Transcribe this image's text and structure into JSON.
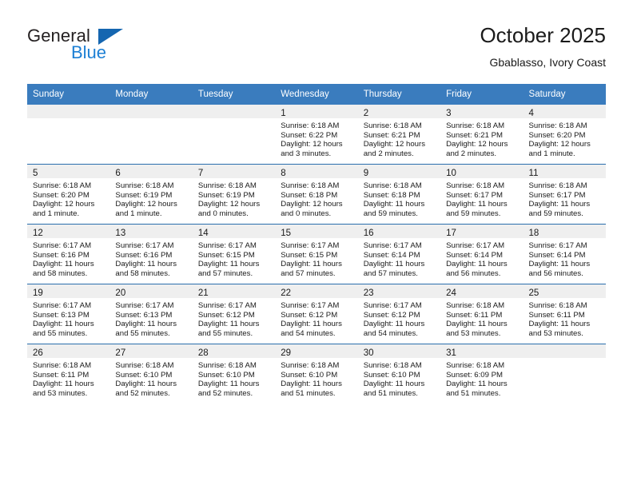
{
  "brand": {
    "name_part1": "General",
    "name_part2": "Blue",
    "logo_icon": "triangle-logo-icon",
    "accent_color": "#1566b0",
    "blue_text_color": "#1c7fd4"
  },
  "header": {
    "title": "October 2025",
    "subtitle": "Gbablasso, Ivory Coast"
  },
  "calendar": {
    "header_bg": "#3a7cbe",
    "daynum_bg": "#efefef",
    "row_border_color": "#2a6ead",
    "weekdays": [
      "Sunday",
      "Monday",
      "Tuesday",
      "Wednesday",
      "Thursday",
      "Friday",
      "Saturday"
    ],
    "weeks": [
      [
        {
          "day": "",
          "empty": true,
          "sunrise": "",
          "sunset": "",
          "daylight_line1": "",
          "daylight_line2": ""
        },
        {
          "day": "",
          "empty": true,
          "sunrise": "",
          "sunset": "",
          "daylight_line1": "",
          "daylight_line2": ""
        },
        {
          "day": "",
          "empty": true,
          "sunrise": "",
          "sunset": "",
          "daylight_line1": "",
          "daylight_line2": ""
        },
        {
          "day": "1",
          "empty": false,
          "sunrise": "Sunrise: 6:18 AM",
          "sunset": "Sunset: 6:22 PM",
          "daylight_line1": "Daylight: 12 hours",
          "daylight_line2": "and 3 minutes."
        },
        {
          "day": "2",
          "empty": false,
          "sunrise": "Sunrise: 6:18 AM",
          "sunset": "Sunset: 6:21 PM",
          "daylight_line1": "Daylight: 12 hours",
          "daylight_line2": "and 2 minutes."
        },
        {
          "day": "3",
          "empty": false,
          "sunrise": "Sunrise: 6:18 AM",
          "sunset": "Sunset: 6:21 PM",
          "daylight_line1": "Daylight: 12 hours",
          "daylight_line2": "and 2 minutes."
        },
        {
          "day": "4",
          "empty": false,
          "sunrise": "Sunrise: 6:18 AM",
          "sunset": "Sunset: 6:20 PM",
          "daylight_line1": "Daylight: 12 hours",
          "daylight_line2": "and 1 minute."
        }
      ],
      [
        {
          "day": "5",
          "empty": false,
          "sunrise": "Sunrise: 6:18 AM",
          "sunset": "Sunset: 6:20 PM",
          "daylight_line1": "Daylight: 12 hours",
          "daylight_line2": "and 1 minute."
        },
        {
          "day": "6",
          "empty": false,
          "sunrise": "Sunrise: 6:18 AM",
          "sunset": "Sunset: 6:19 PM",
          "daylight_line1": "Daylight: 12 hours",
          "daylight_line2": "and 1 minute."
        },
        {
          "day": "7",
          "empty": false,
          "sunrise": "Sunrise: 6:18 AM",
          "sunset": "Sunset: 6:19 PM",
          "daylight_line1": "Daylight: 12 hours",
          "daylight_line2": "and 0 minutes."
        },
        {
          "day": "8",
          "empty": false,
          "sunrise": "Sunrise: 6:18 AM",
          "sunset": "Sunset: 6:18 PM",
          "daylight_line1": "Daylight: 12 hours",
          "daylight_line2": "and 0 minutes."
        },
        {
          "day": "9",
          "empty": false,
          "sunrise": "Sunrise: 6:18 AM",
          "sunset": "Sunset: 6:18 PM",
          "daylight_line1": "Daylight: 11 hours",
          "daylight_line2": "and 59 minutes."
        },
        {
          "day": "10",
          "empty": false,
          "sunrise": "Sunrise: 6:18 AM",
          "sunset": "Sunset: 6:17 PM",
          "daylight_line1": "Daylight: 11 hours",
          "daylight_line2": "and 59 minutes."
        },
        {
          "day": "11",
          "empty": false,
          "sunrise": "Sunrise: 6:18 AM",
          "sunset": "Sunset: 6:17 PM",
          "daylight_line1": "Daylight: 11 hours",
          "daylight_line2": "and 59 minutes."
        }
      ],
      [
        {
          "day": "12",
          "empty": false,
          "sunrise": "Sunrise: 6:17 AM",
          "sunset": "Sunset: 6:16 PM",
          "daylight_line1": "Daylight: 11 hours",
          "daylight_line2": "and 58 minutes."
        },
        {
          "day": "13",
          "empty": false,
          "sunrise": "Sunrise: 6:17 AM",
          "sunset": "Sunset: 6:16 PM",
          "daylight_line1": "Daylight: 11 hours",
          "daylight_line2": "and 58 minutes."
        },
        {
          "day": "14",
          "empty": false,
          "sunrise": "Sunrise: 6:17 AM",
          "sunset": "Sunset: 6:15 PM",
          "daylight_line1": "Daylight: 11 hours",
          "daylight_line2": "and 57 minutes."
        },
        {
          "day": "15",
          "empty": false,
          "sunrise": "Sunrise: 6:17 AM",
          "sunset": "Sunset: 6:15 PM",
          "daylight_line1": "Daylight: 11 hours",
          "daylight_line2": "and 57 minutes."
        },
        {
          "day": "16",
          "empty": false,
          "sunrise": "Sunrise: 6:17 AM",
          "sunset": "Sunset: 6:14 PM",
          "daylight_line1": "Daylight: 11 hours",
          "daylight_line2": "and 57 minutes."
        },
        {
          "day": "17",
          "empty": false,
          "sunrise": "Sunrise: 6:17 AM",
          "sunset": "Sunset: 6:14 PM",
          "daylight_line1": "Daylight: 11 hours",
          "daylight_line2": "and 56 minutes."
        },
        {
          "day": "18",
          "empty": false,
          "sunrise": "Sunrise: 6:17 AM",
          "sunset": "Sunset: 6:14 PM",
          "daylight_line1": "Daylight: 11 hours",
          "daylight_line2": "and 56 minutes."
        }
      ],
      [
        {
          "day": "19",
          "empty": false,
          "sunrise": "Sunrise: 6:17 AM",
          "sunset": "Sunset: 6:13 PM",
          "daylight_line1": "Daylight: 11 hours",
          "daylight_line2": "and 55 minutes."
        },
        {
          "day": "20",
          "empty": false,
          "sunrise": "Sunrise: 6:17 AM",
          "sunset": "Sunset: 6:13 PM",
          "daylight_line1": "Daylight: 11 hours",
          "daylight_line2": "and 55 minutes."
        },
        {
          "day": "21",
          "empty": false,
          "sunrise": "Sunrise: 6:17 AM",
          "sunset": "Sunset: 6:12 PM",
          "daylight_line1": "Daylight: 11 hours",
          "daylight_line2": "and 55 minutes."
        },
        {
          "day": "22",
          "empty": false,
          "sunrise": "Sunrise: 6:17 AM",
          "sunset": "Sunset: 6:12 PM",
          "daylight_line1": "Daylight: 11 hours",
          "daylight_line2": "and 54 minutes."
        },
        {
          "day": "23",
          "empty": false,
          "sunrise": "Sunrise: 6:17 AM",
          "sunset": "Sunset: 6:12 PM",
          "daylight_line1": "Daylight: 11 hours",
          "daylight_line2": "and 54 minutes."
        },
        {
          "day": "24",
          "empty": false,
          "sunrise": "Sunrise: 6:18 AM",
          "sunset": "Sunset: 6:11 PM",
          "daylight_line1": "Daylight: 11 hours",
          "daylight_line2": "and 53 minutes."
        },
        {
          "day": "25",
          "empty": false,
          "sunrise": "Sunrise: 6:18 AM",
          "sunset": "Sunset: 6:11 PM",
          "daylight_line1": "Daylight: 11 hours",
          "daylight_line2": "and 53 minutes."
        }
      ],
      [
        {
          "day": "26",
          "empty": false,
          "sunrise": "Sunrise: 6:18 AM",
          "sunset": "Sunset: 6:11 PM",
          "daylight_line1": "Daylight: 11 hours",
          "daylight_line2": "and 53 minutes."
        },
        {
          "day": "27",
          "empty": false,
          "sunrise": "Sunrise: 6:18 AM",
          "sunset": "Sunset: 6:10 PM",
          "daylight_line1": "Daylight: 11 hours",
          "daylight_line2": "and 52 minutes."
        },
        {
          "day": "28",
          "empty": false,
          "sunrise": "Sunrise: 6:18 AM",
          "sunset": "Sunset: 6:10 PM",
          "daylight_line1": "Daylight: 11 hours",
          "daylight_line2": "and 52 minutes."
        },
        {
          "day": "29",
          "empty": false,
          "sunrise": "Sunrise: 6:18 AM",
          "sunset": "Sunset: 6:10 PM",
          "daylight_line1": "Daylight: 11 hours",
          "daylight_line2": "and 51 minutes."
        },
        {
          "day": "30",
          "empty": false,
          "sunrise": "Sunrise: 6:18 AM",
          "sunset": "Sunset: 6:10 PM",
          "daylight_line1": "Daylight: 11 hours",
          "daylight_line2": "and 51 minutes."
        },
        {
          "day": "31",
          "empty": false,
          "sunrise": "Sunrise: 6:18 AM",
          "sunset": "Sunset: 6:09 PM",
          "daylight_line1": "Daylight: 11 hours",
          "daylight_line2": "and 51 minutes."
        },
        {
          "day": "",
          "empty": true,
          "sunrise": "",
          "sunset": "",
          "daylight_line1": "",
          "daylight_line2": ""
        }
      ]
    ]
  }
}
